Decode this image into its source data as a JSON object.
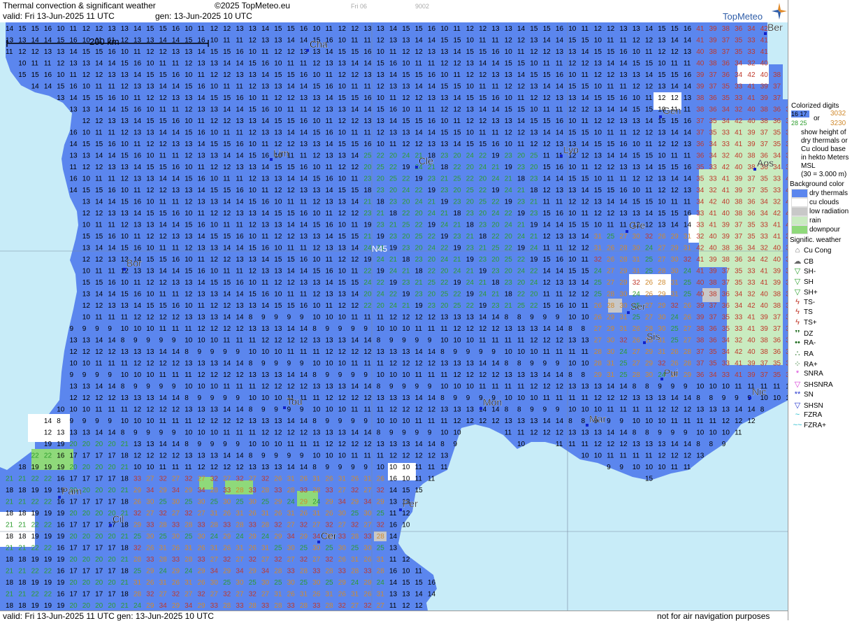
{
  "header": {
    "title": "Thermal convection & significant weather",
    "copyright": "©2025 TopMeteo.eu",
    "valid": "valid:  Fri  13-Jun-2025  11 UTC",
    "gen": "gen: 13-Jun-2025 10 UTC",
    "ghost_day": "Fri 06",
    "ghost_code": "9002",
    "brand": "TopMeteo"
  },
  "footer": {
    "valid": "valid:  Fri  13-Jun-2025  11 UTC       gen: 13-Jun-2025 10 UTC",
    "note": "not for air navigation purposes"
  },
  "map": {
    "scale_label": "200 km",
    "grid_label": "N45",
    "cities": [
      "Cha",
      "Ber",
      "Gen",
      "Lim",
      "Cle",
      "Lyo",
      "Aos",
      "Gre",
      "Bor",
      "Ser",
      "Sis",
      "Pui",
      "Tou",
      "Mon",
      "Nic",
      "Mar",
      "Pam",
      "Per",
      "Cil",
      "Cer"
    ]
  },
  "legend": {
    "digits_title": "Colorized digits",
    "digits_sample_a": "16 17",
    "digits_sample_b": "28 25",
    "digits_or": "or",
    "digits_sample_c": "3032",
    "digits_sample_d": "3230",
    "digits_desc": [
      "show height of",
      "dry thermals or",
      "Cu cloud base",
      "in hekto Meters",
      "MSL",
      "(30 = 3.000 m)"
    ],
    "bg_title": "Background color",
    "bg_items": [
      {
        "label": "dry thermals",
        "color": "#5b86ee"
      },
      {
        "label": "cu clouds",
        "color": "#ffffff"
      },
      {
        "label": "low radiation",
        "color": "#c8c8c8"
      },
      {
        "label": "rain",
        "color": "#c9ebc0"
      },
      {
        "label": "downpour",
        "color": "#8fd97a"
      }
    ],
    "wx_title": "Signific. weather",
    "wx_items": [
      {
        "label": "Cu Cong",
        "icon": "cu-cong-icon",
        "color": "#666666"
      },
      {
        "label": "CB",
        "icon": "cb-icon",
        "color": "#666666"
      },
      {
        "label": "SH-",
        "icon": "shower-light-icon",
        "color": "#2a9d2a"
      },
      {
        "label": "SH",
        "icon": "shower-icon",
        "color": "#2a9d2a"
      },
      {
        "label": "SH+",
        "icon": "shower-heavy-icon",
        "color": "#2a9d2a"
      },
      {
        "label": "TS-",
        "icon": "thunder-light-icon",
        "color": "#c0392b"
      },
      {
        "label": "TS",
        "icon": "thunder-icon",
        "color": "#c0392b"
      },
      {
        "label": "TS+",
        "icon": "thunder-heavy-icon",
        "color": "#c0392b"
      },
      {
        "label": "DZ",
        "icon": "drizzle-icon",
        "color": "#1e6b1e"
      },
      {
        "label": "RA-",
        "icon": "rain-light-icon",
        "color": "#1e6b1e"
      },
      {
        "label": "RA",
        "icon": "rain-icon",
        "color": "#1e6b1e"
      },
      {
        "label": "RA+",
        "icon": "rain-heavy-icon",
        "color": "#1e6b1e"
      },
      {
        "label": "SNRA",
        "icon": "snow-rain-icon",
        "color": "#d63ad6"
      },
      {
        "label": "SHSNRA",
        "icon": "snow-rain-shower-icon",
        "color": "#d63ad6"
      },
      {
        "label": "SN",
        "icon": "snow-icon",
        "color": "#2233cc"
      },
      {
        "label": "SHSN",
        "icon": "snow-shower-icon",
        "color": "#2233cc"
      },
      {
        "label": "FZRA",
        "icon": "freezing-rain-icon",
        "color": "#22bbcc"
      },
      {
        "label": "FZRA+",
        "icon": "freezing-rain-heavy-icon",
        "color": "#22bbcc"
      }
    ]
  },
  "colors": {
    "sea": "#c8ecf8",
    "land": "#5b86ee",
    "text_low": "#000000",
    "text_mid": "#2e9d2e",
    "text_high": "#d08a2e",
    "text_top": "#c0392b"
  }
}
